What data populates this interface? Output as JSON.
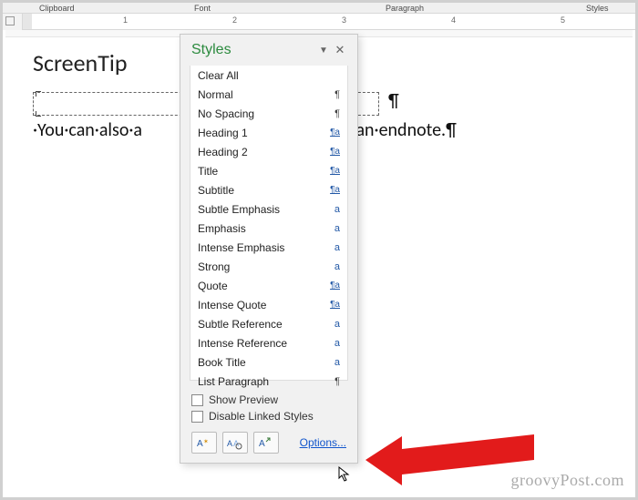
{
  "ribbon": {
    "clipboard": "Clipboard",
    "font": "Font",
    "paragraph": "Paragraph",
    "styles": "Styles"
  },
  "ruler": {
    "n1": "1",
    "n2": "2",
    "n3": "3",
    "n4": "4",
    "n5": "5"
  },
  "document": {
    "title_text": "ScreenTip",
    "body_text_before": "·You·can·also·a",
    "body_text_after": "g·an·endnote.¶",
    "para_mark": "¶"
  },
  "styles_pane": {
    "title": "Styles",
    "items": [
      {
        "name": "Clear All",
        "sym": "",
        "kind": "none"
      },
      {
        "name": "Normal",
        "sym": "¶",
        "kind": "para"
      },
      {
        "name": "No Spacing",
        "sym": "¶",
        "kind": "para"
      },
      {
        "name": "Heading 1",
        "sym": "¶a",
        "kind": "linked"
      },
      {
        "name": "Heading 2",
        "sym": "¶a",
        "kind": "linked"
      },
      {
        "name": "Title",
        "sym": "¶a",
        "kind": "linked"
      },
      {
        "name": "Subtitle",
        "sym": "¶a",
        "kind": "linked"
      },
      {
        "name": "Subtle Emphasis",
        "sym": "a",
        "kind": "char"
      },
      {
        "name": "Emphasis",
        "sym": "a",
        "kind": "char"
      },
      {
        "name": "Intense Emphasis",
        "sym": "a",
        "kind": "char"
      },
      {
        "name": "Strong",
        "sym": "a",
        "kind": "char"
      },
      {
        "name": "Quote",
        "sym": "¶a",
        "kind": "linked"
      },
      {
        "name": "Intense Quote",
        "sym": "¶a",
        "kind": "linked"
      },
      {
        "name": "Subtle Reference",
        "sym": "a",
        "kind": "char"
      },
      {
        "name": "Intense Reference",
        "sym": "a",
        "kind": "char"
      },
      {
        "name": "Book Title",
        "sym": "a",
        "kind": "char"
      },
      {
        "name": "List Paragraph",
        "sym": "¶",
        "kind": "para"
      }
    ],
    "show_preview": "Show Preview",
    "disable_linked": "Disable Linked Styles",
    "options": "Options..."
  },
  "watermark": "groovyPost.com"
}
